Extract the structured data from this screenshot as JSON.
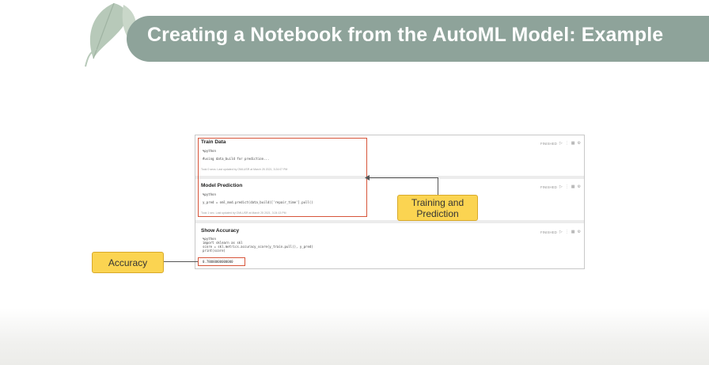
{
  "slide": {
    "title": "Creating a Notebook from the AutoML Model: Example"
  },
  "colors": {
    "banner": "#8ea39a",
    "callout": "#fbd451",
    "highlight": "#d7553a"
  },
  "notebook": {
    "paragraphs": [
      {
        "title": "Train Data",
        "code": "%python\n\n#using data_build for prediction...",
        "meta": "Took 0 secs. Last updated by OMLUSR at March 25 2021, 3:24:07 PM",
        "status": "FINISHED"
      },
      {
        "title": "Model Prediction",
        "code": "%python\n\ny_pred = oml_mod.predict(data_build)['repair_time'].pull()",
        "meta": "Took 1 sec. Last updated by OMLUSR at March 25 2021, 3:24:13 PM",
        "status": "FINISHED"
      },
      {
        "title": "Show Accuracy",
        "code": "%python\nimport sklearn as skl\nscore = skl.metrics.accuracy_score(y_train.pull(), y_pred)\nprint(score)",
        "output": "0.78000000000000",
        "status": "FINISHED"
      }
    ]
  },
  "callouts": {
    "training": "Training and Prediction",
    "accuracy": "Accuracy"
  },
  "icons": {
    "run": "play-icon",
    "toolbar": [
      "expand-icon",
      "table-icon",
      "gear-icon"
    ]
  }
}
